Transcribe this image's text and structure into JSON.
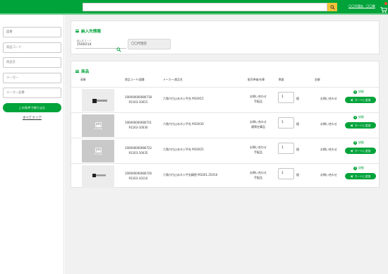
{
  "header": {
    "search_value": "",
    "user_link": "〇〇代理店　〇〇様",
    "search_icon": "search-icon",
    "cart_icon": "cart-icon",
    "colors": {
      "bar": "#00a33a",
      "search_button": "#f4c236",
      "badge": "#ff4a2a"
    }
  },
  "sidebar": {
    "fields": [
      {
        "placeholder": "図番"
      },
      {
        "placeholder": "商品コード"
      },
      {
        "placeholder": "商品名"
      },
      {
        "placeholder": "メーカー"
      },
      {
        "placeholder": "メーカー品番"
      }
    ],
    "search_button": "この条件で絞り込む",
    "clear_link": "すべてクリア"
  },
  "delivery": {
    "title": "納入先情報",
    "code_label": "納入先コード",
    "code_value": "1500214",
    "site_name": "〇〇代理店"
  },
  "products": {
    "title": "商品",
    "columns": {
      "image": "画像",
      "code": "商品コード/図番",
      "name": "メーカー/商品名",
      "status": "販売単価/在庫",
      "qty": "数量",
      "price": "金額"
    },
    "qty_unit": "個",
    "detail_label": "詳細",
    "cart_label": "カートに追加",
    "no_image_caption": "no image",
    "rows": [
      {
        "product_code": "100000000080718",
        "drawing_no": "91163-10015",
        "name": "六角穴付止めネジ平先 M10X15",
        "price_text": "お問い合わせ",
        "stock": "手配品",
        "qty": "1",
        "amount": "お問い合わせ",
        "image": "photo"
      },
      {
        "product_code": "100000000080721",
        "drawing_no": "91163-10030",
        "name": "六角穴付止めネジ平先 M10X30",
        "price_text": "お問い合わせ",
        "stock": "通常在庫品",
        "qty": "1",
        "amount": "お問い合わせ",
        "image": "no-image"
      },
      {
        "product_code": "100000000080722",
        "drawing_no": "91163-10035",
        "name": "六角穴付止めネジ平先 M10X25",
        "price_text": "お問い合わせ",
        "stock": "手配品",
        "qty": "1",
        "amount": "お問い合わせ",
        "image": "no-image"
      },
      {
        "product_code": "100000000080726",
        "drawing_no": "91163-10110",
        "name": "六角穴付止めネジ平先精密 M10X1.25X10",
        "price_text": "お問い合わせ",
        "stock": "手配品",
        "qty": "1",
        "amount": "お問い合わせ",
        "image": "photo"
      }
    ]
  }
}
